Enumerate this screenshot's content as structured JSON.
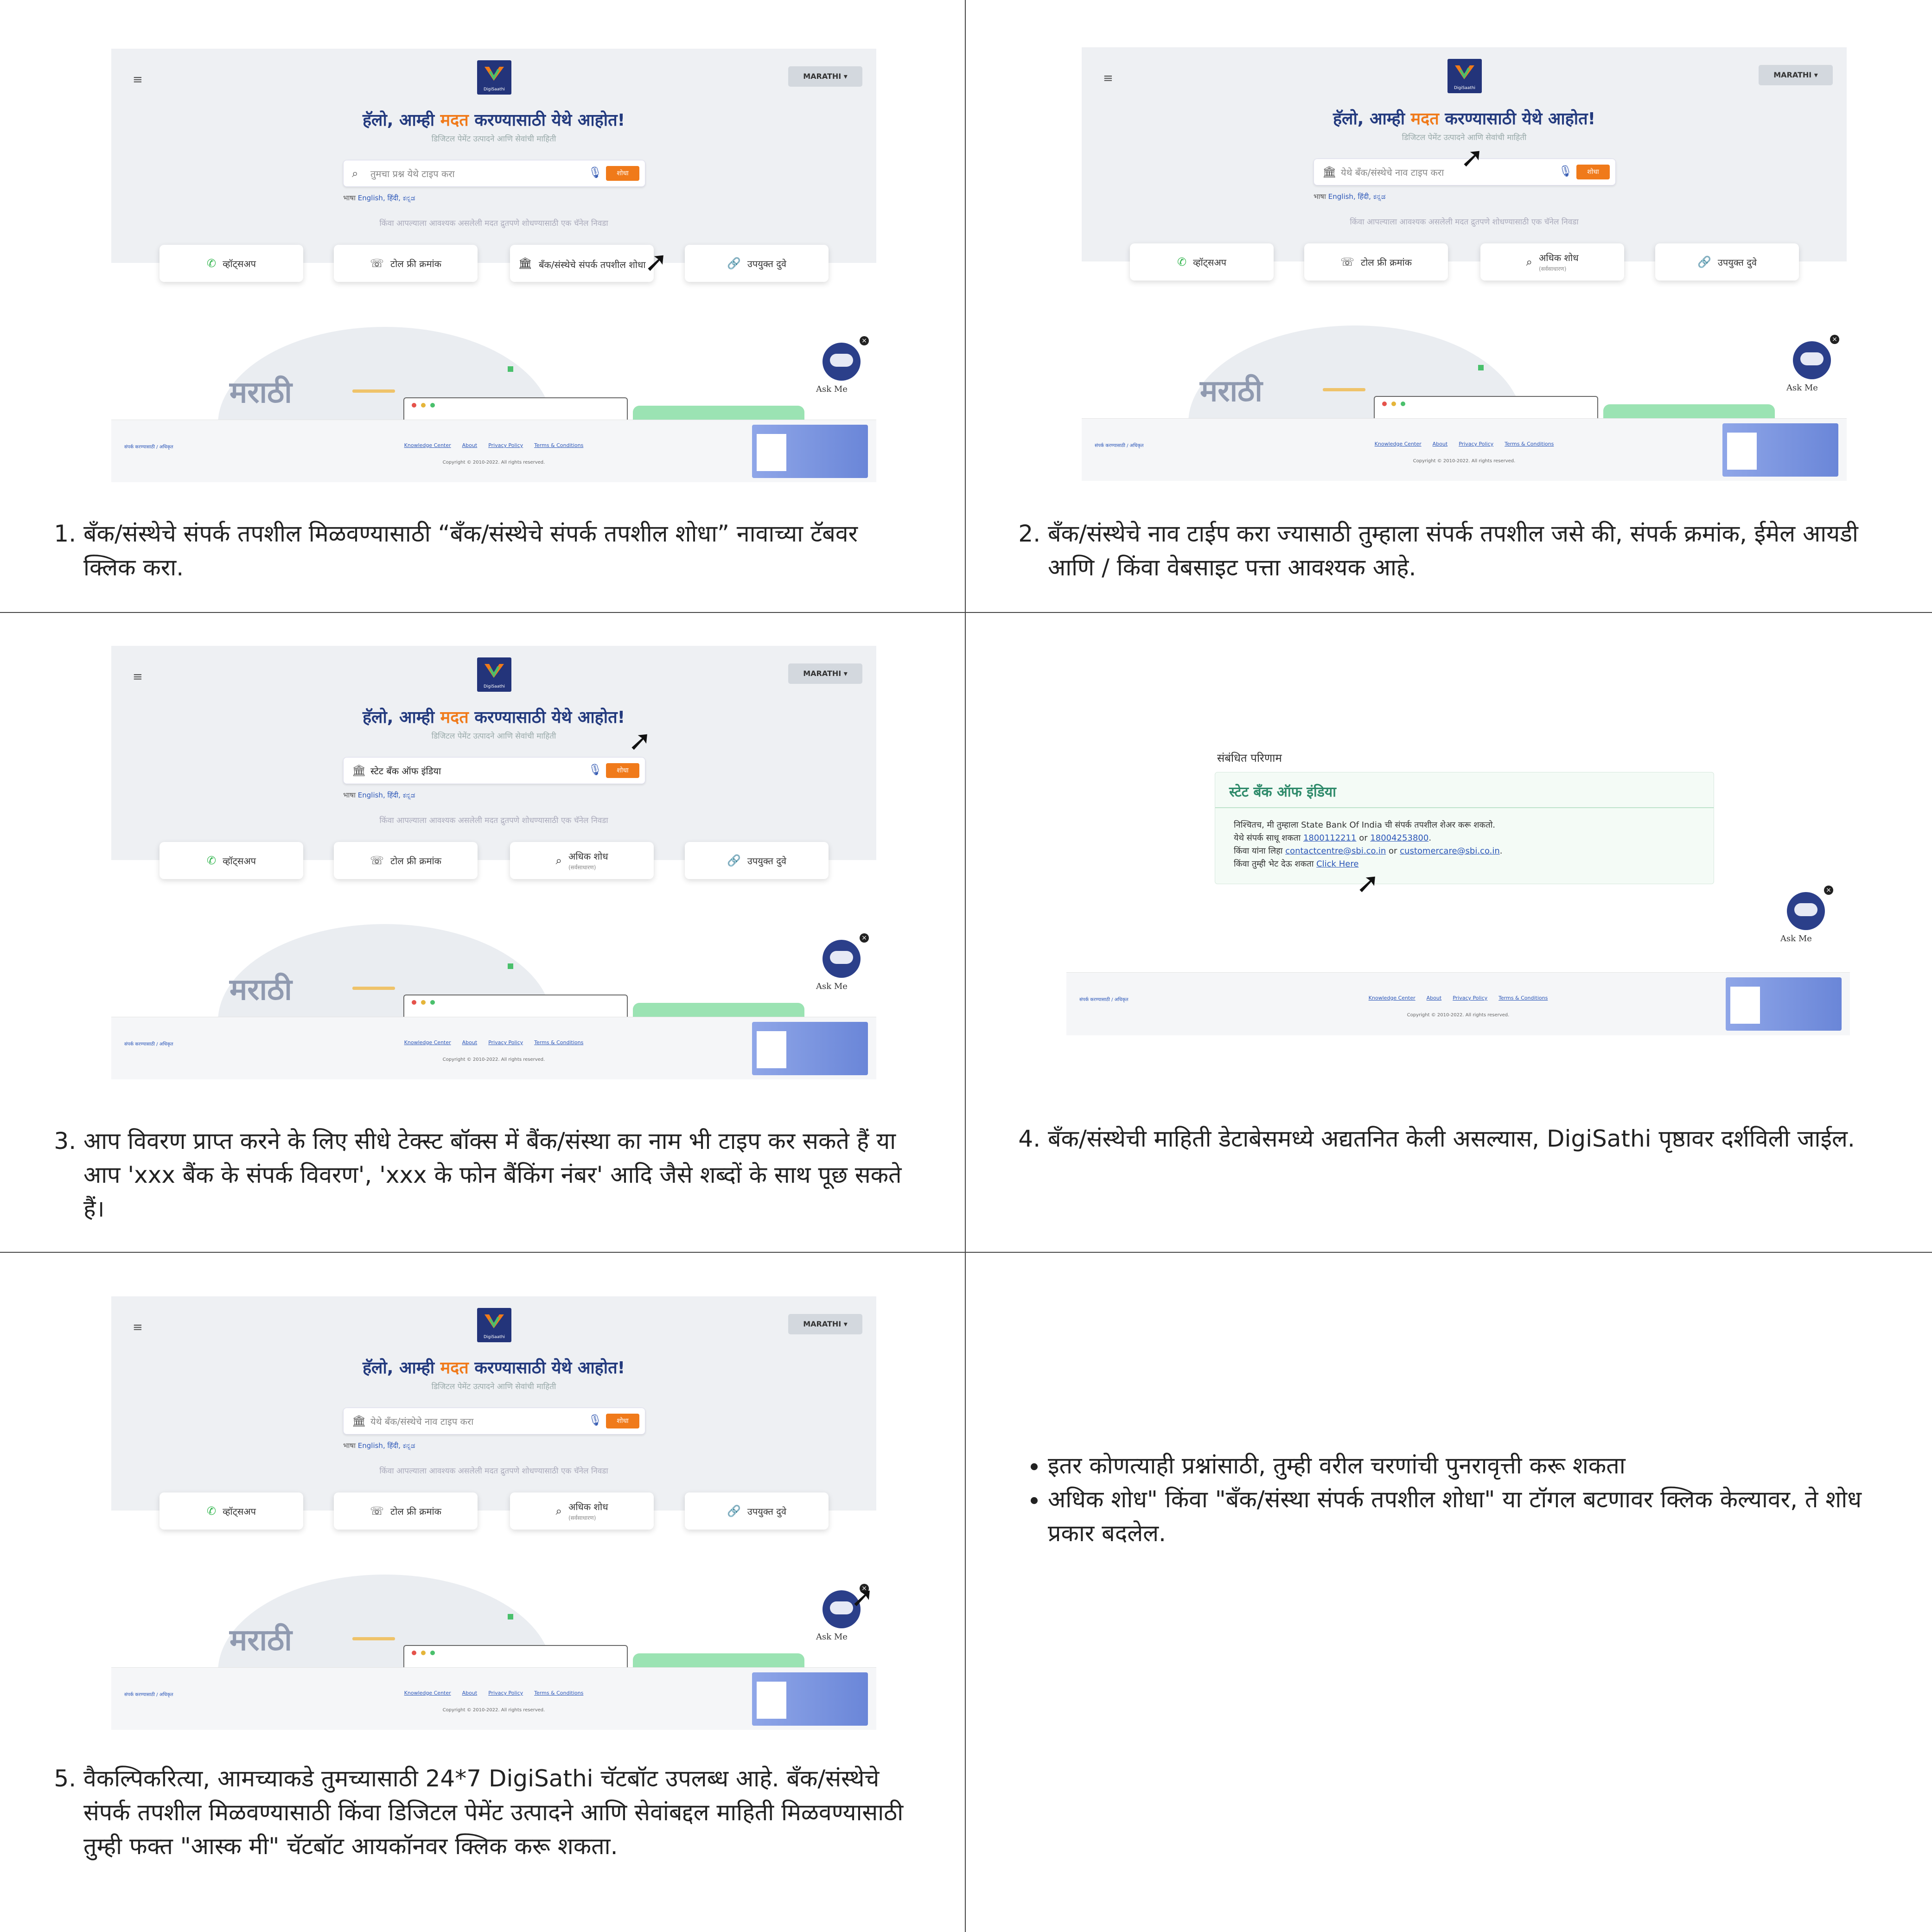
{
  "shot": {
    "menu_icon": "hamburger-icon",
    "logo_text": "DigiSaathi",
    "lang_button": "MARATHI ▾",
    "headline_pre": "हॅलो, आम्ही ",
    "headline_mid": "मदत",
    "headline_post": " करण्यासाठी येथे आहोत!",
    "subline": "डिजिटल पेमेंट उत्पादने आणि सेवांची माहिती",
    "search_placeholder": "तुमचा प्रश्न येथे टाइप करा",
    "search_placeholder_bank": "येथे बँक/संस्थेचे नाव टाइप करा",
    "search_filled": "स्टेट बँक ऑफ इंडिया",
    "search_button": "शोधा",
    "lang_label": "भाषा",
    "lang_links": "English, हिंदी, ಕನ್ನಡ",
    "alt_line": "किंवा आपल्याला आवश्यक असलेली मदत द्रुतपणे शोधण्यासाठी एक चॅनेल निवडा",
    "tiles": {
      "whatsapp": "व्हॉट्सअप",
      "tollfree": "टोल फ्री क्रमांक",
      "bank_contact": "बँक/संस्थेचे संपर्क तपशील शोधा",
      "more_search": "अधिक शोध",
      "more_search_sub": "(सर्वसाधारण)",
      "links": "उपयुक्त दुवे"
    },
    "bg_text": "मराठी",
    "askme": "Ask Me",
    "footer_left": "संपर्क करण्यासाठी / अधिकृत",
    "footer_links": [
      "Knowledge Center",
      "About",
      "Privacy Policy",
      "Terms & Conditions"
    ],
    "copyright": "Copyright © 2010-2022. All rights reserved."
  },
  "result": {
    "label": "संबंधित परिणाम",
    "bank": "स्टेट बँक ऑफ इंडिया",
    "line1": "निश्चितच, मी तुम्हाला State Bank Of India ची संपर्क तपशील शेअर करू शकतो.",
    "line2_pre": "येथे संपर्क साधू शकता ",
    "phone1": "1800112211",
    "or": " or ",
    "phone2": "18004253800",
    "line3_pre": "किंवा यांना लिहा ",
    "email1": "contactcentre@sbi.co.in",
    "email2": "customercare@sbi.co.in",
    "line4_pre": "किंवा तुम्ही भेट देऊ शकता ",
    "click": "Click Here"
  },
  "captions": {
    "c1": "बँक/संस्थेचे संपर्क तपशील मिळवण्यासाठी “बँक/संस्थेचे संपर्क तपशील शोधा” नावाच्या टॅबवर क्लिक करा.",
    "c2": "बँक/संस्थेचे नाव टाईप करा ज्यासाठी तुम्हाला संपर्क तपशील जसे की, संपर्क क्रमांक, ईमेल आयडी आणि / किंवा वेबसाइट पत्ता आवश्यक आहे.",
    "c3": "आप विवरण प्राप्त करने के लिए सीधे टेक्स्ट बॉक्स में बैंक/संस्था का नाम भी टाइप कर सकते हैं या आप 'xxx बैंक के संपर्क विवरण', 'xxx के फोन बैंकिंग नंबर' आदि जैसे शब्दों के साथ पूछ सकते हैं।",
    "c4": "बँक/संस्थेची माहिती डेटाबेसमध्ये अद्यतनित केली असल्यास, DigiSathi पृष्ठावर दर्शविली जाईल.",
    "c5": "वैकल्पिकरित्या, आमच्याकडे तुमच्यासाठी 24*7 DigiSathi चॅटबॉट उपलब्ध आहे. बँक/संस्थेचे संपर्क तपशील मिळवण्यासाठी किंवा डिजिटल पेमेंट उत्पादने आणि सेवांबद्दल माहिती मिळवण्यासाठी तुम्ही फक्त \"आस्क मी\" चॅटबॉट आयकॉनवर क्लिक करू शकता.",
    "b1": "इतर कोणत्याही प्रश्नांसाठी, तुम्ही वरील चरणांची पुनरावृत्ती करू शकता",
    "b2": "अधिक शोध\" किंवा \"बँक/संस्था संपर्क तपशील शोधा\" या टॉगल बटणावर क्लिक केल्यावर, ते शोध प्रकार बदलेल."
  }
}
